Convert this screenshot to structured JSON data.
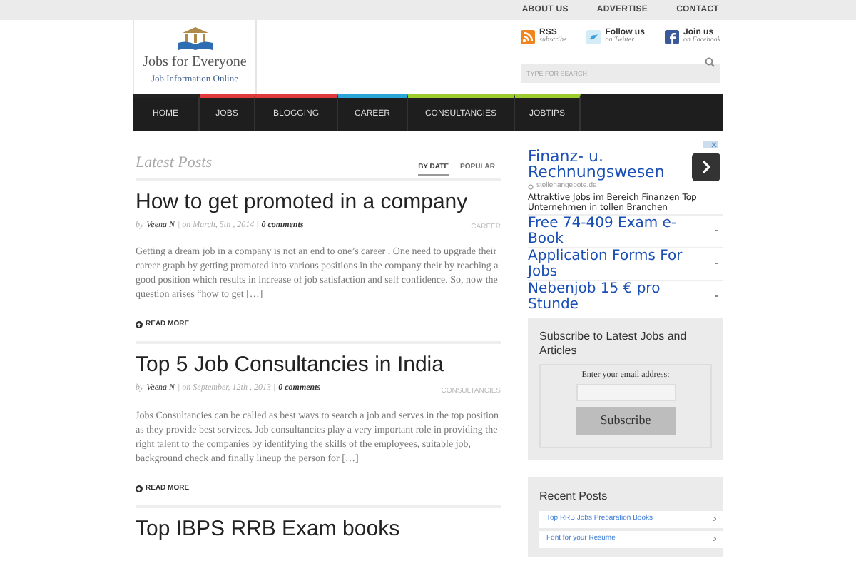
{
  "top_links": [
    "ABOUT US",
    "ADVERTISE",
    "CONTACT"
  ],
  "logo": {
    "title": "Jobs for Everyone",
    "tagline": "Job Information Online"
  },
  "social": [
    {
      "kind": "rss",
      "title": "RSS",
      "sub": "subscribe"
    },
    {
      "kind": "twitter",
      "title": "Follow us",
      "sub": "on Twitter"
    },
    {
      "kind": "facebook",
      "title": "Join us",
      "sub": "on Facebook"
    }
  ],
  "search": {
    "placeholder": "TYPE FOR SEARCH"
  },
  "nav": [
    {
      "label": "HOME",
      "color": "#222222"
    },
    {
      "label": "JOBS",
      "color": "#e03a3a"
    },
    {
      "label": "BLOGGING",
      "color": "#e03a3a"
    },
    {
      "label": "CAREER",
      "color": "#2aa6d8"
    },
    {
      "label": "CONSULTANCIES",
      "color": "#9ccc2e"
    },
    {
      "label": "JOBTIPS",
      "color": "#9ccc2e"
    }
  ],
  "latest": {
    "title": "Latest Posts",
    "tabs": [
      {
        "label": "BY DATE",
        "selected": true
      },
      {
        "label": "POPULAR",
        "selected": false
      }
    ]
  },
  "posts": [
    {
      "title": "How to get promoted in a company",
      "by": "by",
      "author": "Veena N",
      "date": "| on March, 5th , 2014 |",
      "comments": "0 comments",
      "category": "CAREER",
      "excerpt": "Getting a dream job in a company is not an end to one’s career . One need to upgrade their career graph by getting promoted into various positions in the company their by reaching a good position which results in increase of job satisfaction and self confidence. So, now the question arises “how to get […]",
      "more": "READ MORE"
    },
    {
      "title": "Top 5 Job Consultancies in India",
      "by": "by",
      "author": "Veena N",
      "date": "| on September, 12th , 2013 |",
      "comments": "0 comments",
      "category": "CONSULTANCIES",
      "excerpt": "Jobs Consultancies can be called as best ways to search a job and serves in the top position as they provide best services. Job consultancies play a very important role in providing the right talent to the companies by identifying the skills of the employees, suitable job, background check and finally lineup the person for […]",
      "more": "READ MORE"
    },
    {
      "title": "Top IBPS RRB Exam books"
    }
  ],
  "ad": {
    "headline": "Finanz- u. Rechnungswesen",
    "domain": "stellenangebote.de",
    "text": "Attraktive Jobs im Bereich Finanzen Top Unternehmen in tollen Branchen",
    "links": [
      "Free 74-409 Exam e-Book",
      "Application Forms For Jobs",
      "Nebenjob 15 € pro Stunde"
    ]
  },
  "subscribe": {
    "title": "Subscribe to Latest Jobs and Articles",
    "label": "Enter your email address:",
    "button": "Subscribe"
  },
  "recent": {
    "title": "Recent Posts",
    "items": [
      "Top RRB Jobs Preparation Books",
      "Font for your Resume"
    ]
  }
}
